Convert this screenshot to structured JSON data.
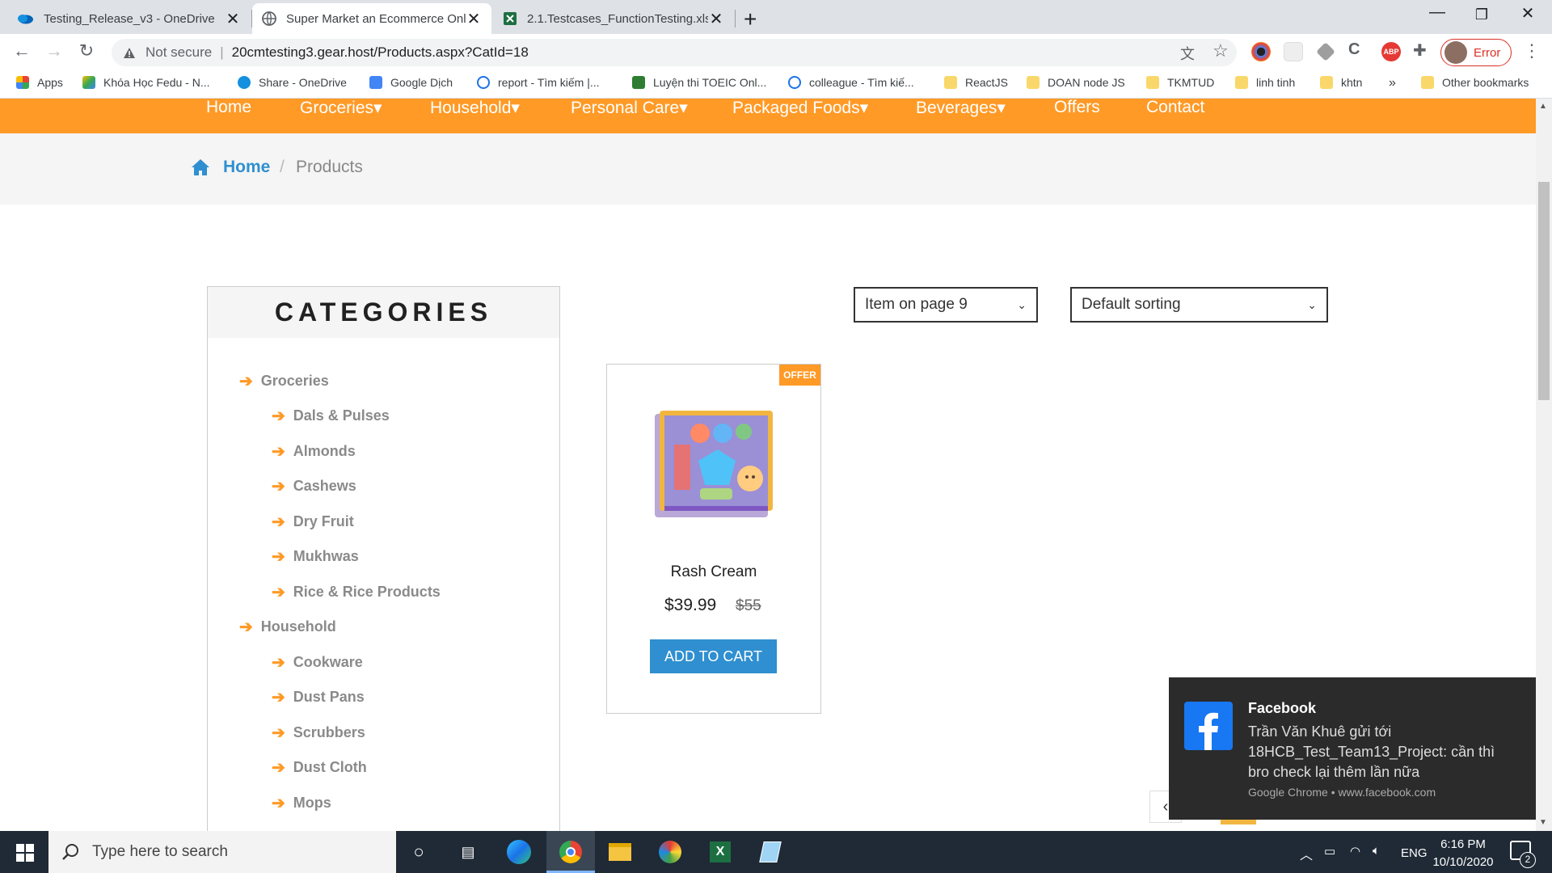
{
  "browser": {
    "tabs": [
      {
        "title": "Testing_Release_v3 - OneDrive"
      },
      {
        "title": "Super Market an Ecommerce Onl"
      },
      {
        "title": "2.1.Testcases_FunctionTesting.xlsx"
      }
    ],
    "address": {
      "security": "Not secure",
      "url": "20cmtesting3.gear.host/Products.aspx?CatId=18"
    },
    "profile_label": "Error",
    "bookmarks": [
      {
        "label": "Apps"
      },
      {
        "label": "Khóa Học Fedu - N..."
      },
      {
        "label": "Share - OneDrive"
      },
      {
        "label": "Google Dịch"
      },
      {
        "label": "report - Tìm kiếm |..."
      },
      {
        "label": "Luyện thi TOEIC Onl..."
      },
      {
        "label": "colleague - Tìm kiế..."
      },
      {
        "label": "ReactJS"
      },
      {
        "label": "DOAN node JS"
      },
      {
        "label": "TKMTUD"
      },
      {
        "label": "linh tinh"
      },
      {
        "label": "khtn"
      }
    ],
    "more_bookmarks": "»",
    "other_bookmarks": "Other bookmarks"
  },
  "site": {
    "menu": [
      {
        "label": "Home"
      },
      {
        "label": "Groceries▾"
      },
      {
        "label": "Household▾"
      },
      {
        "label": "Personal Care▾"
      },
      {
        "label": "Packaged Foods▾"
      },
      {
        "label": "Beverages▾"
      },
      {
        "label": "Offers"
      },
      {
        "label": "Contact"
      }
    ],
    "breadcrumb": {
      "home": "Home",
      "separator": "/",
      "current": "Products"
    },
    "filters": {
      "items_per_page": "Item on page 9",
      "sorting": "Default sorting"
    },
    "categories": {
      "title": "CATEGORIES",
      "groups": [
        {
          "name": "Groceries",
          "items": [
            "Dals & Pulses",
            "Almonds",
            "Cashews",
            "Dry Fruit",
            "Mukhwas",
            "Rice & Rice Products"
          ]
        },
        {
          "name": "Household",
          "items": [
            "Cookware",
            "Dust Pans",
            "Scrubbers",
            "Dust Cloth",
            "Mops"
          ]
        }
      ]
    },
    "product": {
      "badge": "OFFER",
      "name": "Rash Cream",
      "price": "$39.99",
      "old_price": "$55",
      "button": "ADD TO CART"
    }
  },
  "notification": {
    "app": "Facebook",
    "message": "Trần Văn Khuê gửi tới 18HCB_Test_Team13_Project: cần thì bro check lại thêm lần nữa",
    "source": "Google Chrome • www.facebook.com"
  },
  "taskbar": {
    "search_placeholder": "Type here to search",
    "lang": "ENG",
    "time": "6:16 PM",
    "date": "10/10/2020",
    "notif_count": "2"
  },
  "colors": {
    "accent": "#ff9a26",
    "link": "#2f8fd0",
    "taskbar": "#1f2a36"
  }
}
